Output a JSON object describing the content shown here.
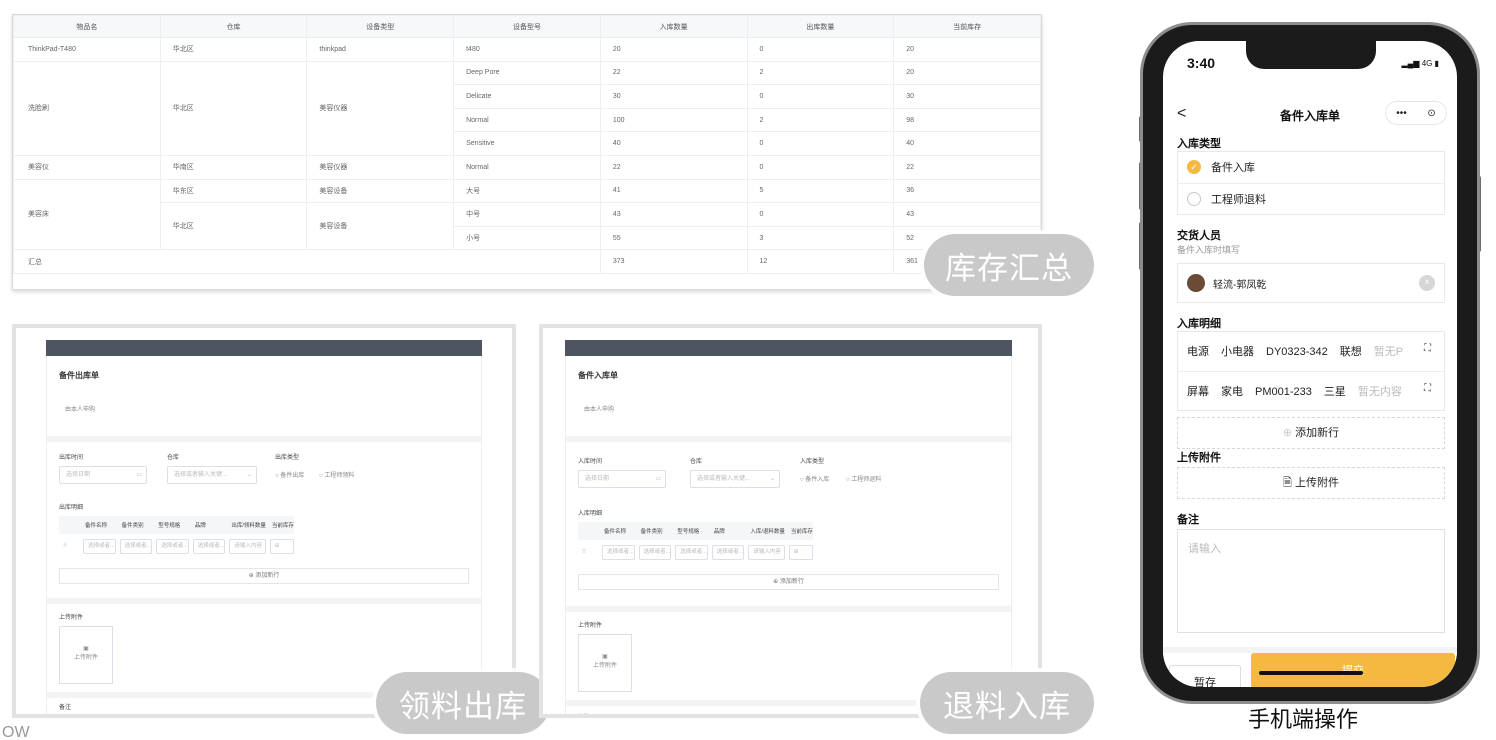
{
  "inventory": {
    "headers": [
      "物品名",
      "仓库",
      "设备类型",
      "设备型号",
      "入库数量",
      "出库数量",
      "当前库存"
    ],
    "rows": [
      {
        "name": "ThinkPad-T480",
        "warehouse": "华北区",
        "type": "thinkpad",
        "model": "t480",
        "in": "20",
        "out": "0",
        "stock": "20"
      },
      {
        "name": "洗脸刷",
        "warehouse": "华北区",
        "type": "美容仪器",
        "model": "Deep Pore",
        "in": "22",
        "out": "2",
        "stock": "20"
      },
      {
        "model": "Delicate",
        "in": "30",
        "out": "0",
        "stock": "30"
      },
      {
        "model": "Normal",
        "in": "100",
        "out": "2",
        "stock": "98"
      },
      {
        "model": "Sensitive",
        "in": "40",
        "out": "0",
        "stock": "40"
      },
      {
        "name": "美容仪",
        "warehouse": "华南区",
        "type": "美容仪器",
        "model": "Normal",
        "in": "22",
        "out": "0",
        "stock": "22"
      },
      {
        "name": "美容床",
        "warehouse": "华东区",
        "type": "美容设备",
        "model": "大号",
        "in": "41",
        "out": "5",
        "stock": "36"
      },
      {
        "warehouse": "华北区",
        "type": "美容设备",
        "model": "中号",
        "in": "43",
        "out": "0",
        "stock": "43"
      },
      {
        "model": "小号",
        "in": "55",
        "out": "3",
        "stock": "52"
      }
    ],
    "total": {
      "label": "汇总",
      "in": "373",
      "out": "12",
      "stock": "361"
    }
  },
  "labels": {
    "inventory_summary": "库存汇总",
    "material_out": "领料出库",
    "material_return": "退料入库",
    "mobile_caption": "手机端操作",
    "corner_fragment": "OW"
  },
  "out_form": {
    "title": "备件出库单",
    "subtitle": "由本人申购",
    "time_label": "出库时间",
    "time_placeholder": "选择日期",
    "warehouse_label": "仓库",
    "warehouse_placeholder": "选择或者输入关键...",
    "type_label": "出库类型",
    "type_options": [
      "备件出库",
      "工程师领料"
    ],
    "detail_label": "出库明细",
    "columns": [
      "备件名称",
      "备件类别",
      "型号规格",
      "品牌",
      "出库/领料数量",
      "当前库存"
    ],
    "cell_placeholder": "选择或者...",
    "qty_placeholder": "请输入内容",
    "add_row": "添加新行",
    "upload_label": "上传附件",
    "upload_button": "上传附件",
    "remark_label": "备注"
  },
  "in_form": {
    "title": "备件入库单",
    "subtitle": "由本人申购",
    "time_label": "入库时间",
    "time_placeholder": "选择日期",
    "warehouse_label": "仓库",
    "warehouse_placeholder": "选择或者输入关键...",
    "type_label": "入库类型",
    "type_options": [
      "备件入库",
      "工程师退料"
    ],
    "detail_label": "入库明细",
    "columns": [
      "备件名称",
      "备件类别",
      "型号规格",
      "品牌",
      "入库/退料数量",
      "当前库存"
    ],
    "cell_placeholder": "选择或者...",
    "qty_placeholder": "请输入内容",
    "add_row": "添加新行",
    "upload_label": "上传附件",
    "upload_button": "上传附件",
    "remark_label": "备注"
  },
  "mobile": {
    "time": "3:40",
    "status": "4G",
    "back": "<",
    "title": "备件入库单",
    "capsule_more": "•••",
    "capsule_close": "⊙",
    "type_label": "入库类型",
    "option_selected": "备件入库",
    "option_other": "工程师退料",
    "deliverer_label": "交货人员",
    "deliverer_hint": "备件入库时填写",
    "deliverer_value": "轻流-郭凤乾",
    "detail_label": "入库明细",
    "detail_rows": [
      {
        "name": "电源",
        "category": "小电器",
        "model": "DY0323-342",
        "brand": "联想",
        "extra": "暂无P"
      },
      {
        "name": "屏幕",
        "category": "家电",
        "model": "PM001-233",
        "brand": "三星",
        "extra": "暂无内容"
      }
    ],
    "add_row": "添加新行",
    "upload_label": "上传附件",
    "upload_button": "上传附件",
    "remark_label": "备注",
    "remark_placeholder": "请输入",
    "save_button": "暂存",
    "submit_button": "提交"
  }
}
